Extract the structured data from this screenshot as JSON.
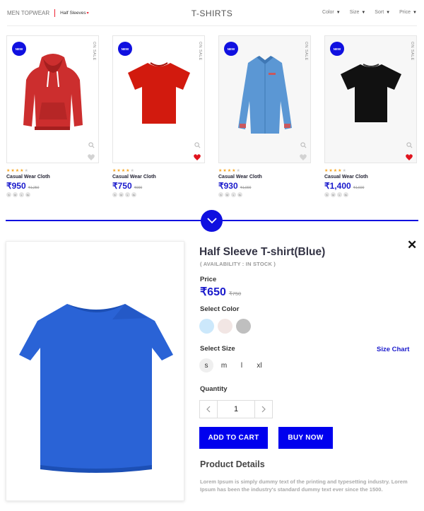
{
  "header": {
    "breadcrumb_category": "MEN TOPWEAR",
    "breadcrumb_sub": "Half Sleeves",
    "title": "T-SHIRTS",
    "filters": [
      "Color",
      "Size",
      "Sort",
      "Price"
    ]
  },
  "products": [
    {
      "badge": "NEW",
      "tag": "ON SALE",
      "name": "Casual Wear Cloth",
      "price": "₹950",
      "old_price": "₹1,250",
      "rating": 4,
      "max_rating": 5,
      "sizes": [
        "S",
        "M",
        "L",
        "XL"
      ],
      "favorited": false,
      "color": "#cc2e2e"
    },
    {
      "badge": "NEW",
      "tag": "ON SALE",
      "name": "Casual Wear Cloth",
      "price": "₹750",
      "old_price": "₹900",
      "rating": 4,
      "max_rating": 5,
      "sizes": [
        "S",
        "M",
        "L",
        "XL"
      ],
      "favorited": true,
      "color": "#d21a0e"
    },
    {
      "badge": "NEW",
      "tag": "ON SALE",
      "name": "Casual Wear Cloth",
      "price": "₹930",
      "old_price": "₹1,000",
      "rating": 4,
      "max_rating": 5,
      "sizes": [
        "S",
        "M",
        "L",
        "XL"
      ],
      "favorited": false,
      "color": "#5b97d4"
    },
    {
      "badge": "NEW",
      "tag": "ON SALE",
      "name": "Casual Wear Cloth",
      "price": "₹1,400",
      "old_price": "₹1,600",
      "rating": 4,
      "max_rating": 5,
      "sizes": [
        "S",
        "M",
        "L",
        "XL"
      ],
      "favorited": true,
      "color": "#111111"
    }
  ],
  "detail": {
    "title": "Half Sleeve T-shirt(Blue)",
    "availability": "( AVAILABILITY : IN STOCK )",
    "price_label": "Price",
    "price": "₹650",
    "old_price": "₹750",
    "color_label": "Select Color",
    "colors": [
      "#cce8fb",
      "#f2e6e4",
      "#bfbfbf"
    ],
    "size_label": "Select Size",
    "size_chart": "Size Chart",
    "sizes": [
      "s",
      "m",
      "l",
      "xl"
    ],
    "selected_size": "s",
    "quantity_label": "Quantity",
    "quantity": "1",
    "add_to_cart": "ADD TO CART",
    "buy_now": "BUY NOW",
    "details_label": "Product Details",
    "description": "Lorem Ipsum is simply dummy text of the printing and typesetting industry. Lorem Ipsum has been the industry's standard dummy text ever since the 1500.",
    "image_color": "#2a63d6"
  },
  "colors": {
    "accent": "#1010e0",
    "price": "#1a1acc",
    "heart_active": "#e0141e",
    "star": "#f5a623"
  }
}
